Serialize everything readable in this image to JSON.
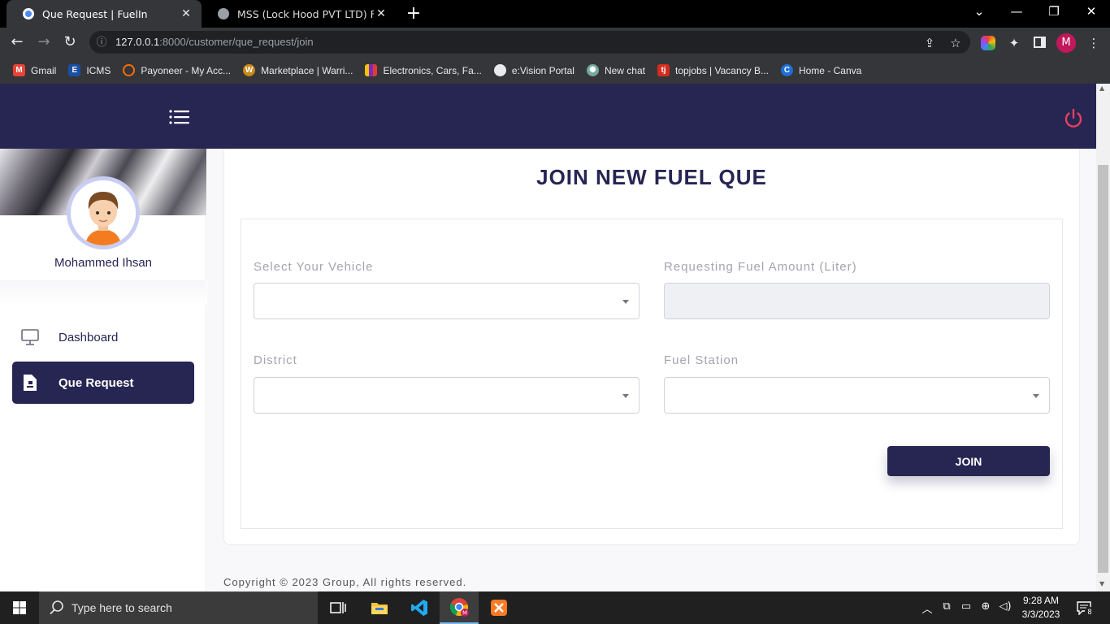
{
  "browser": {
    "tabs": [
      {
        "title": "Que Request | FuelIn",
        "active": true
      },
      {
        "title": "MSS (Lock Hood PVT LTD) Final R",
        "active": false
      }
    ],
    "url_host": "127.0.0.1",
    "url_path": ":8000/customer/que_request/join",
    "profile_initial": "M",
    "bookmarks": [
      {
        "label": "Gmail",
        "icon": "gmail-icon",
        "color": "#ea4335",
        "glyph": "M"
      },
      {
        "label": "ICMS",
        "icon": "icms-icon",
        "color": "#1a4fa3",
        "glyph": "E"
      },
      {
        "label": "Payoneer - My Acc...",
        "icon": "payoneer-icon",
        "color": "#ff6d00",
        "glyph": "○"
      },
      {
        "label": "Marketplace | Warri...",
        "icon": "warrior-icon",
        "color": "#c98a17",
        "glyph": "W"
      },
      {
        "label": "Electronics, Cars, Fa...",
        "icon": "ikman-icon",
        "color": "#f2c400",
        "glyph": "▮"
      },
      {
        "label": "e:Vision Portal",
        "icon": "globe-icon",
        "color": "#5f6368",
        "glyph": "◍"
      },
      {
        "label": "New chat",
        "icon": "chatgpt-icon",
        "color": "#74aa9c",
        "glyph": "✺"
      },
      {
        "label": "topjobs | Vacancy B...",
        "icon": "topjobs-icon",
        "color": "#d52b1e",
        "glyph": "tj"
      },
      {
        "label": "Home - Canva",
        "icon": "canva-icon",
        "color": "#00c4cc",
        "glyph": "C"
      }
    ]
  },
  "app": {
    "user_name": "Mohammed Ihsan",
    "nav": [
      {
        "label": "Dashboard",
        "icon": "monitor-icon",
        "active": false
      },
      {
        "label": "Que Request",
        "icon": "file-icon",
        "active": true
      }
    ],
    "page_title": "JOIN NEW FUEL QUE",
    "form": {
      "vehicle_label": "Select Your Vehicle",
      "vehicle_value": "",
      "amount_label": "Requesting Fuel Amount (Liter)",
      "amount_value": "",
      "district_label": "District",
      "district_value": "",
      "station_label": "Fuel Station",
      "station_value": "",
      "submit_label": "JOIN"
    },
    "footer": "Copyright © 2023 Group, All rights reserved.",
    "colors": {
      "primary": "#272552",
      "power": "#e4405f"
    }
  },
  "taskbar": {
    "search_placeholder": "Type here to search",
    "time": "9:28 AM",
    "date": "3/3/2023",
    "notification_count": "8"
  }
}
